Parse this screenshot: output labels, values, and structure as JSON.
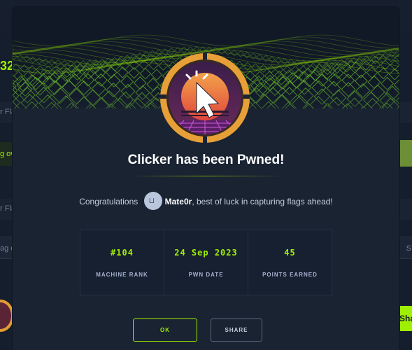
{
  "background": {
    "left_fragments": [
      "32",
      "r Fla",
      "g ov",
      "r Fla",
      "ag c"
    ],
    "right_fragment_search": "S",
    "right_button_fragment": "Sha"
  },
  "modal": {
    "title": "Clicker has been Pwned!",
    "congrats_prefix": "Congratulations",
    "username": "Mate0r",
    "congrats_suffix": ", best of luck in capturing flags ahead!",
    "stats": [
      {
        "value": "#104",
        "label": "MACHINE RANK"
      },
      {
        "value": "24 Sep 2023",
        "label": "PWN DATE"
      },
      {
        "value": "45",
        "label": "POINTS EARNED"
      }
    ],
    "ok_label": "OK",
    "share_label": "SHARE"
  },
  "colors": {
    "accent_green": "#9fef00",
    "logo_ring": "#e79f38",
    "background": "#1a2332"
  }
}
